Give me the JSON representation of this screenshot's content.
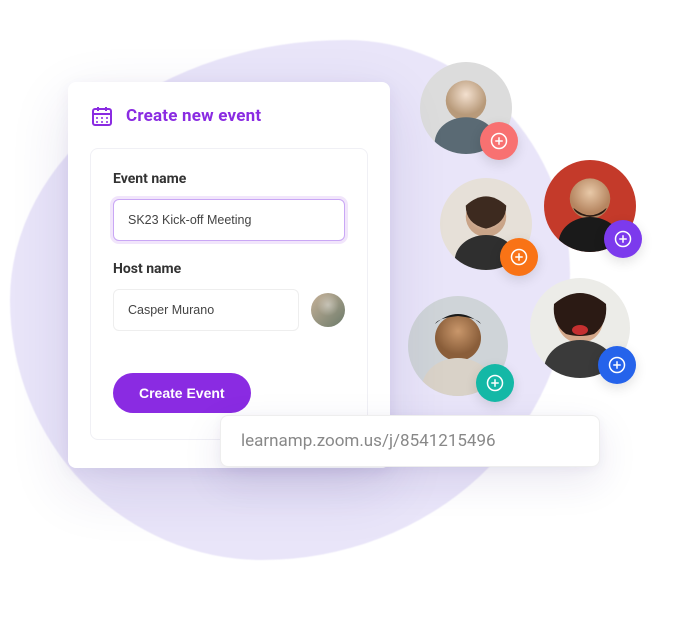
{
  "header": {
    "title": "Create new event",
    "icon": "calendar-icon"
  },
  "form": {
    "event_name_label": "Event name",
    "event_name_value": "SK23 Kick-off Meeting",
    "host_name_label": "Host name",
    "host_name_value": "Casper Murano",
    "submit_label": "Create Event"
  },
  "url_bar": {
    "text": "learnamp.zoom.us/j/8541215496"
  },
  "people": [
    {
      "id": "person-1",
      "badge_color": "#f87171"
    },
    {
      "id": "person-2",
      "badge_color": "#f97316"
    },
    {
      "id": "person-3",
      "badge_color": "#7c3aed"
    },
    {
      "id": "person-4",
      "badge_color": "#14b8a6"
    },
    {
      "id": "person-5",
      "badge_color": "#2563eb"
    }
  ],
  "colors": {
    "accent": "#8a2be2",
    "blob": "#e9e5f9"
  }
}
